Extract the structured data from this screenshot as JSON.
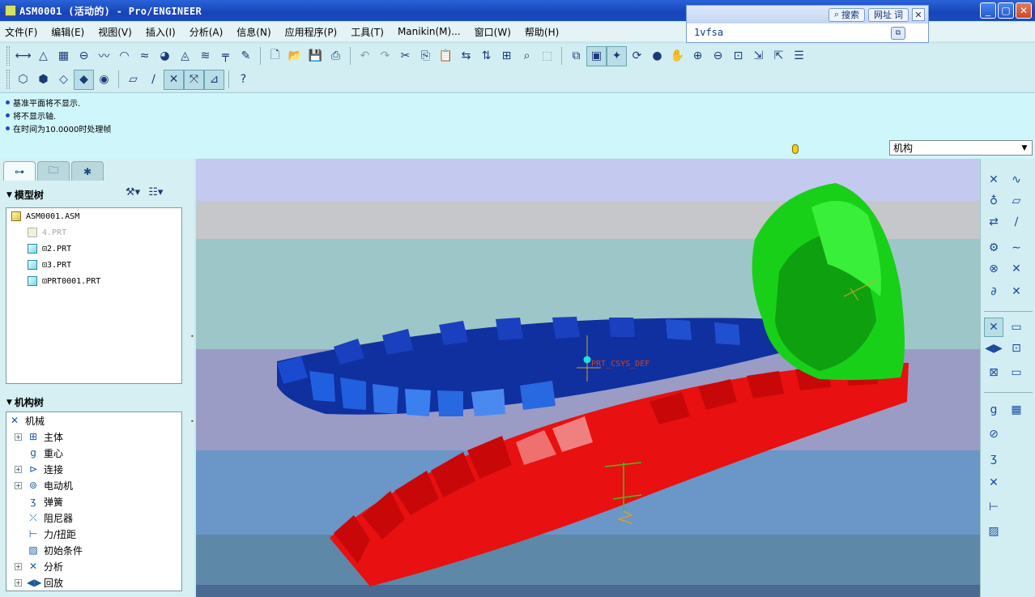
{
  "window": {
    "title": "ASM0001 (活动的) - Pro/ENGINEER",
    "buttons": {
      "minimize": "_",
      "maximize": "▢",
      "close": "✕"
    }
  },
  "search_widget": {
    "search_label": "搜索",
    "url_label": "网址",
    "word_label": "词",
    "input_value": "1vfsa",
    "close": "✕",
    "go": "⧉"
  },
  "menu": {
    "items": [
      "文件(F)",
      "编辑(E)",
      "视图(V)",
      "插入(I)",
      "分析(A)",
      "信息(N)",
      "应用程序(P)",
      "工具(T)",
      "Manikin(M)...",
      "窗口(W)",
      "帮助(H)"
    ]
  },
  "toolbar1": {
    "groupA": [
      "dim-icon",
      "measure-icon",
      "table-icon",
      "section-icon",
      "curve-analysis-icon",
      "surface-icon",
      "wave-icon",
      "shade-icon",
      "draft-icon",
      "slope-icon",
      "ruler-icon",
      "pencil-icon"
    ],
    "groupB": [
      "new-file-icon",
      "open-folder-icon",
      "save-icon",
      "print-icon"
    ],
    "groupC": [
      "undo-icon",
      "redo-icon",
      "cut-icon",
      "copy-icon",
      "paste-icon",
      "regenerate-icon",
      "regen-manager-icon",
      "model-tree-icon",
      "find-icon",
      "select-box-icon"
    ],
    "groupD": [
      "view-manager-icon",
      "repaint-icon",
      "spin-center-icon",
      "orient-icon",
      "appearance-icon",
      "pan-icon",
      "zoom-in-icon",
      "zoom-out-icon",
      "refit-icon",
      "named-view-icon",
      "saved-views-icon",
      "layers-icon"
    ],
    "glyphs": {
      "dim-icon": "⟷",
      "measure-icon": "△",
      "table-icon": "▦",
      "section-icon": "⊖",
      "curve-analysis-icon": "〰",
      "surface-icon": "◠",
      "wave-icon": "≈",
      "shade-icon": "◕",
      "draft-icon": "◬",
      "slope-icon": "≋",
      "ruler-icon": "╤",
      "pencil-icon": "✎",
      "new-file-icon": "🗋",
      "open-folder-icon": "📂",
      "save-icon": "💾",
      "print-icon": "⎙",
      "undo-icon": "↶",
      "redo-icon": "↷",
      "cut-icon": "✂",
      "copy-icon": "⎘",
      "paste-icon": "📋",
      "regenerate-icon": "⇆",
      "regen-manager-icon": "⇅",
      "model-tree-icon": "⊞",
      "find-icon": "⌕",
      "select-box-icon": "⬚",
      "view-manager-icon": "⧉",
      "repaint-icon": "▣",
      "spin-center-icon": "✦",
      "orient-icon": "⟳",
      "appearance-icon": "●",
      "pan-icon": "✋",
      "zoom-in-icon": "⊕",
      "zoom-out-icon": "⊖",
      "refit-icon": "⊡",
      "named-view-icon": "⇲",
      "saved-views-icon": "⇱",
      "layers-icon": "☰"
    }
  },
  "toolbar2": {
    "groupA": [
      "wireframe-icon",
      "hidden-line-icon",
      "no-hidden-icon",
      "shading-icon",
      "realtime-render-icon"
    ],
    "groupB": [
      "datum-plane-display-icon",
      "datum-axis-display-icon",
      "point-display-icon",
      "csys-display-icon",
      "annotation-display-icon"
    ],
    "groupC": [
      "whats-this-icon"
    ],
    "glyphs": {
      "wireframe-icon": "⬡",
      "hidden-line-icon": "⬢",
      "no-hidden-icon": "◇",
      "shading-icon": "◆",
      "realtime-render-icon": "◉",
      "datum-plane-display-icon": "▱",
      "datum-axis-display-icon": "∕",
      "point-display-icon": "✕",
      "csys-display-icon": "⤧",
      "annotation-display-icon": "⊿",
      "whats-this-icon": "?"
    }
  },
  "messages": [
    "基准平面将不显示.",
    "将不显示轴.",
    "在时间为10.0000时处理帧"
  ],
  "filter": {
    "value": "机构"
  },
  "model_tree": {
    "title": "模型树",
    "items": [
      {
        "label": "ASM0001.ASM",
        "level": 0,
        "kind": "asm",
        "dim": false
      },
      {
        "label": "4.PRT",
        "level": 1,
        "kind": "part",
        "dim": true
      },
      {
        "label": "⊡2.PRT",
        "level": 1,
        "kind": "part",
        "dim": false
      },
      {
        "label": "⊡3.PRT",
        "level": 1,
        "kind": "part",
        "dim": false
      },
      {
        "label": "⊡PRT0001.PRT",
        "level": 1,
        "kind": "part",
        "dim": false
      }
    ]
  },
  "mech_tree": {
    "title": "机构树",
    "root": "机械",
    "items": [
      {
        "label": "主体",
        "expandable": true,
        "icon": "⊞"
      },
      {
        "label": "重心",
        "expandable": false,
        "icon": "g"
      },
      {
        "label": "连接",
        "expandable": true,
        "icon": "⊳"
      },
      {
        "label": "电动机",
        "expandable": true,
        "icon": "⊚"
      },
      {
        "label": "弹簧",
        "expandable": false,
        "icon": "ʒ"
      },
      {
        "label": "阻尼器",
        "expandable": false,
        "icon": "⤫"
      },
      {
        "label": "力/扭距",
        "expandable": false,
        "icon": "⊢"
      },
      {
        "label": "初始条件",
        "expandable": false,
        "icon": "▨"
      },
      {
        "label": "分析",
        "expandable": true,
        "icon": "✕"
      },
      {
        "label": "回放",
        "expandable": true,
        "icon": "◀▶"
      }
    ]
  },
  "graphics": {
    "csys_label": "PRT_CSYS_DEF",
    "colors": {
      "band1": "#c4c9ef",
      "band2": "#c6c7ca",
      "band3": "#9dc6c8",
      "band4": "#9a9cc5",
      "band5": "#6a96c8",
      "band6": "#5e88a8",
      "band7": "#4b6a92",
      "green_gear": "#18d018",
      "blue_ring": "#1030a0",
      "red_ring": "#e81010"
    }
  },
  "right_toolbar": {
    "glyphs": [
      "✕",
      "∿",
      "♁",
      "▱",
      "⇄",
      "∕",
      "⚙",
      "∼",
      "⊗",
      "✕",
      "∂",
      "✕",
      "✕",
      "▭",
      "◀▶",
      "⊡",
      "⊠",
      "▭",
      "g",
      "▦",
      "⊘",
      "ʒ",
      "✕",
      "⊢",
      "▨",
      "⧉"
    ]
  }
}
